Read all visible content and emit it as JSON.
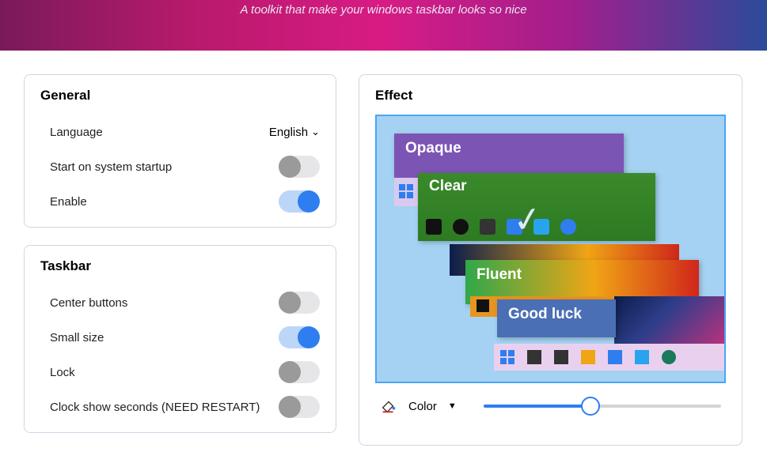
{
  "header": {
    "subtitle": "A toolkit that make your windows taskbar looks so nice"
  },
  "general": {
    "title": "General",
    "language_label": "Language",
    "language_value": "English",
    "start_on_boot_label": "Start on system startup",
    "start_on_boot_on": false,
    "enable_label": "Enable",
    "enable_on": true
  },
  "taskbar": {
    "title": "Taskbar",
    "center_label": "Center buttons",
    "center_on": false,
    "small_label": "Small size",
    "small_on": true,
    "lock_label": "Lock",
    "lock_on": false,
    "clock_label": "Clock show seconds (NEED RESTART)",
    "clock_on": false
  },
  "effect": {
    "title": "Effect",
    "options": {
      "opaque": "Opaque",
      "clear": "Clear",
      "fluent": "Fluent",
      "goodluck": "Good luck"
    },
    "selected": "Clear",
    "color_label": "Color",
    "slider_value": 45
  }
}
